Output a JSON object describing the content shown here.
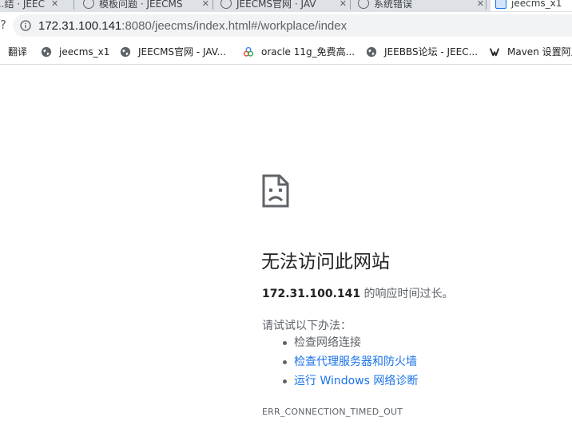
{
  "tabs": [
    {
      "title": "...结 · JEEC",
      "active": false
    },
    {
      "title": "模板问题 · JEECMS",
      "active": false
    },
    {
      "title": "JEECMS官网 · JAV",
      "active": false
    },
    {
      "title": "系统错误",
      "active": false
    },
    {
      "title": "jeecms_x1",
      "active": true
    }
  ],
  "toolbar": {
    "url_host": "172.31.100.141",
    "url_rest": ":8080/jeecms/index.html#/workplace/index"
  },
  "bookmarks": [
    {
      "label": "翻译",
      "icon": "none"
    },
    {
      "label": "jeecms_x1",
      "icon": "globe-icon"
    },
    {
      "label": "JEECMS官网 - JAV...",
      "icon": "globe-icon"
    },
    {
      "label": "oracle 11g_免费高...",
      "icon": "oracle-icon"
    },
    {
      "label": "JEEBBS论坛 - JEEC...",
      "icon": "globe-icon"
    },
    {
      "label": "Maven 设置阿里",
      "icon": "maven-icon"
    }
  ],
  "error": {
    "title": "无法访问此网站",
    "host": "172.31.100.141",
    "summary_tail": " 的响应时间过长。",
    "try_label": "请试试以下办法：",
    "suggestions": [
      {
        "text": "检查网络连接",
        "link": false
      },
      {
        "text": "检查代理服务器和防火墙",
        "link": true
      },
      {
        "text": "运行 Windows 网络诊断",
        "link": true
      }
    ],
    "code": "ERR_CONNECTION_TIMED_OUT"
  },
  "colors": {
    "link": "#1a73e8",
    "text": "#202124",
    "muted": "#5f6368",
    "omnibox_bg": "#f1f3f4",
    "tabstrip_bg": "#dee1e6"
  }
}
